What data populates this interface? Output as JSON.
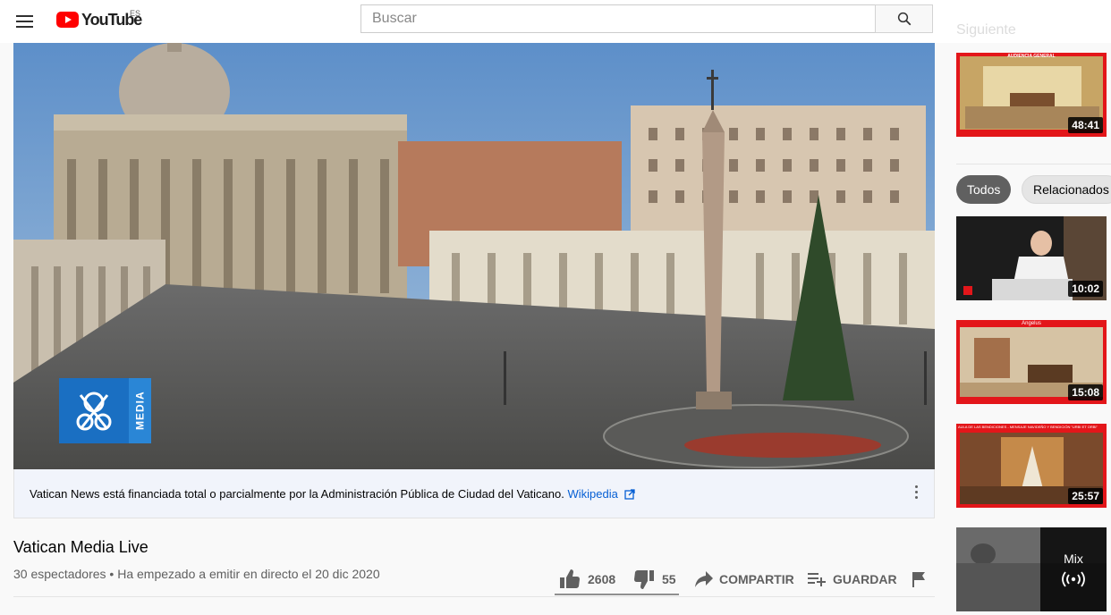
{
  "masthead": {
    "logo_text": "YouTube",
    "country_code": "ES",
    "search_placeholder": "Buscar"
  },
  "info_panel": {
    "text": "Vatican News está financiada total o parcialmente por la Administración Pública de Ciudad del Vaticano.",
    "link": "Wikipedia"
  },
  "player": {
    "watermark_text": "MEDIA"
  },
  "video": {
    "title": "Vatican Media Live",
    "viewers": "30 espectadores",
    "separator": "•",
    "started": "Ha empezado a emitir en directo el 20 dic 2020",
    "likes": "2608",
    "dislikes": "55",
    "share_label": "COMPARTIR",
    "save_label": "GUARDAR"
  },
  "sidebar": {
    "heading": "Siguiente",
    "top_video": {
      "duration": "48:41",
      "banner": "AUDIENCIA GENERAL"
    },
    "chips": [
      "Todos",
      "Relacionados"
    ],
    "videos": [
      {
        "duration": "10:02"
      },
      {
        "duration": "15:08",
        "banner": "Angelus"
      },
      {
        "duration": "25:57",
        "banner": "AULA DE LAS BENDICIONES - MENSAJE NAVIDEÑO Y BENDICIÓN \"URBI ET ORBI\""
      }
    ],
    "mix": {
      "label": "Mix"
    }
  },
  "colors": {
    "brand_red": "#ff0000",
    "link_blue": "#065fd4",
    "vatican_blue": "#1a6fc2",
    "thumb_red": "#e3161a"
  }
}
